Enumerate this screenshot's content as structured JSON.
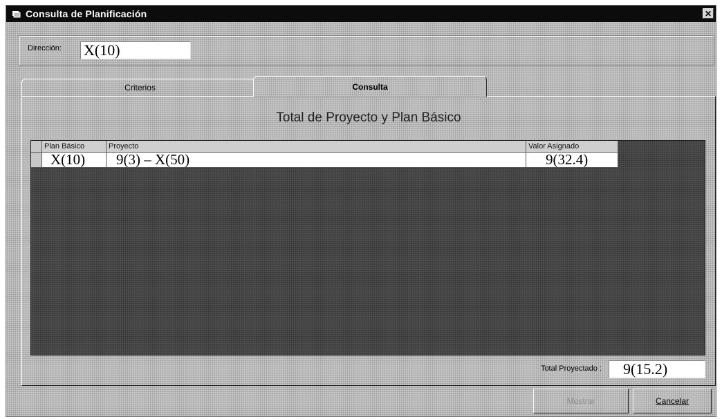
{
  "window": {
    "title": "Consulta de Planificación",
    "close_glyph": "✕"
  },
  "direccion": {
    "label": "Dirección:",
    "value": "X(10)"
  },
  "tabs": [
    {
      "label": "Criterios",
      "active": false
    },
    {
      "label": "Consulta",
      "active": true
    }
  ],
  "panel": {
    "title": "Total de Proyecto y Plan Básico"
  },
  "grid": {
    "columns": [
      "Plan Básico",
      "Proyecto",
      "Valor Asignado"
    ],
    "rows": [
      {
        "plan": "X(10)",
        "proyecto": "9(3) – X(50)",
        "valor": "9(32.4)"
      }
    ]
  },
  "total": {
    "label": "Total Proyectado :",
    "value": "9(15.2)"
  },
  "buttons": {
    "mostrar": "Mostrar",
    "cancelar": "Cancelar"
  }
}
